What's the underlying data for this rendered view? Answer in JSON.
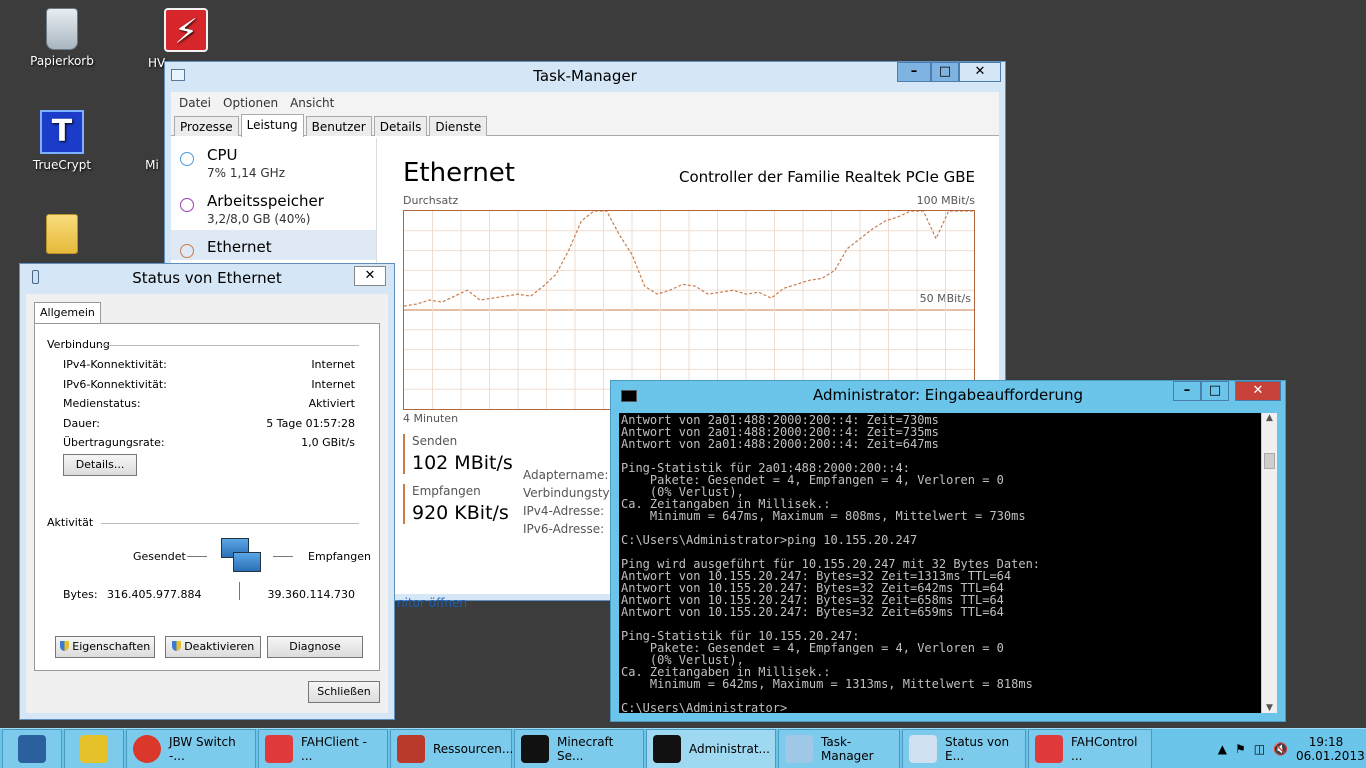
{
  "desktop": {
    "icons": [
      {
        "label": "Papierkorb",
        "icon": "recycle-bin-icon"
      },
      {
        "label": "HV",
        "icon": "hv-app-icon"
      },
      {
        "label": "TrueCrypt",
        "icon": "truecrypt-icon"
      },
      {
        "label": "Mi",
        "icon": "app-icon"
      },
      {
        "label": "",
        "icon": "folder-icon"
      }
    ]
  },
  "taskmgr": {
    "title": "Task-Manager",
    "menu": [
      "Datei",
      "Optionen",
      "Ansicht"
    ],
    "tabs": [
      "Prozesse",
      "Leistung",
      "Benutzer",
      "Details",
      "Dienste"
    ],
    "active_tab": "Leistung",
    "sidebar": [
      {
        "name": "CPU",
        "sub": "7% 1,14 GHz",
        "color": "#4a9bdc"
      },
      {
        "name": "Arbeitsspeicher",
        "sub": "3,2/8,0 GB (40%)",
        "color": "#9c3fb5"
      },
      {
        "name": "Ethernet",
        "sub": "",
        "color": "#c77c4c"
      }
    ],
    "perf": {
      "title": "Ethernet",
      "adapter": "Controller der Familie Realtek PCIe GBE",
      "chart_label": "Durchsatz",
      "chart_max": "100 MBit/s",
      "chart_mid": "50 MBit/s",
      "chart_time": "4 Minuten",
      "send_label": "Senden",
      "send_value": "102 MBit/s",
      "recv_label": "Empfangen",
      "recv_value": "920 KBit/s",
      "kv": [
        "Adaptername:",
        "Verbindungstyp:",
        "IPv4-Adresse:",
        "IPv6-Adresse:"
      ],
      "monitor_link": "nitor öffnen"
    }
  },
  "chart_data": {
    "type": "line",
    "series": [
      {
        "values": [
          52,
          53,
          55,
          54,
          57,
          60,
          55,
          56,
          57,
          58,
          57,
          62,
          68,
          80,
          95,
          100,
          100,
          88,
          78,
          62,
          58,
          60,
          63,
          62,
          58,
          59,
          60,
          58,
          59,
          56,
          61,
          63,
          65,
          66,
          70,
          81,
          86,
          91,
          95,
          97,
          100,
          100,
          86,
          100,
          100,
          100
        ]
      }
    ],
    "ylim": [
      0,
      100
    ],
    "grid": true
  },
  "ethstatus": {
    "title": "Status von Ethernet",
    "tab": "Allgemein",
    "verbindung_label": "Verbindung",
    "rows": [
      {
        "k": "IPv4-Konnektivität:",
        "v": "Internet"
      },
      {
        "k": "IPv6-Konnektivität:",
        "v": "Internet"
      },
      {
        "k": "Medienstatus:",
        "v": "Aktiviert"
      },
      {
        "k": "Dauer:",
        "v": "5 Tage 01:57:28"
      },
      {
        "k": "Übertragungsrate:",
        "v": "1,0 GBit/s"
      }
    ],
    "details_btn": "Details...",
    "aktivitaet_label": "Aktivität",
    "gesendet": "Gesendet",
    "empfangen": "Empfangen",
    "bytes_label": "Bytes:",
    "bytes_sent": "316.405.977.884",
    "bytes_recv": "39.360.114.730",
    "btn_eigenschaften": "Eigenschaften",
    "btn_deaktivieren": "Deaktivieren",
    "btn_diagnose": "Diagnose",
    "btn_schliessen": "Schließen"
  },
  "cmd": {
    "title": "Administrator: Eingabeaufforderung",
    "lines": [
      "Antwort von 2a01:488:2000:200::4: Zeit=730ms",
      "Antwort von 2a01:488:2000:200::4: Zeit=735ms",
      "Antwort von 2a01:488:2000:200::4: Zeit=647ms",
      "",
      "Ping-Statistik für 2a01:488:2000:200::4:",
      "    Pakete: Gesendet = 4, Empfangen = 4, Verloren = 0",
      "    (0% Verlust),",
      "Ca. Zeitangaben in Millisek.:",
      "    Minimum = 647ms, Maximum = 808ms, Mittelwert = 730ms",
      "",
      "C:\\Users\\Administrator>ping 10.155.20.247",
      "",
      "Ping wird ausgeführt für 10.155.20.247 mit 32 Bytes Daten:",
      "Antwort von 10.155.20.247: Bytes=32 Zeit=1313ms TTL=64",
      "Antwort von 10.155.20.247: Bytes=32 Zeit=642ms TTL=64",
      "Antwort von 10.155.20.247: Bytes=32 Zeit=658ms TTL=64",
      "Antwort von 10.155.20.247: Bytes=32 Zeit=659ms TTL=64",
      "",
      "Ping-Statistik für 10.155.20.247:",
      "    Pakete: Gesendet = 4, Empfangen = 4, Verloren = 0",
      "    (0% Verlust),",
      "Ca. Zeitangaben in Millisek.:",
      "    Minimum = 642ms, Maximum = 1313ms, Mittelwert = 818ms",
      "",
      "C:\\Users\\Administrator>_"
    ]
  },
  "taskbar": {
    "items": [
      {
        "label": "",
        "icon": "server-manager-icon",
        "pinned": true
      },
      {
        "label": "",
        "icon": "explorer-icon",
        "pinned": true
      },
      {
        "label": "JBW Switch -...",
        "icon": "chrome-icon"
      },
      {
        "label": "FAHClient - ...",
        "icon": "fah-icon"
      },
      {
        "label": "Ressourcen...",
        "icon": "resource-monitor-icon"
      },
      {
        "label": "Minecraft Se...",
        "icon": "cmd-icon"
      },
      {
        "label": "Administrat...",
        "icon": "cmd-icon",
        "active": true
      },
      {
        "label": "Task-Manager",
        "icon": "taskmgr-icon"
      },
      {
        "label": "Status von E...",
        "icon": "network-icon"
      },
      {
        "label": "FAHControl ...",
        "icon": "fah-icon"
      }
    ],
    "time": "19:18",
    "date": "06.01.2013"
  }
}
